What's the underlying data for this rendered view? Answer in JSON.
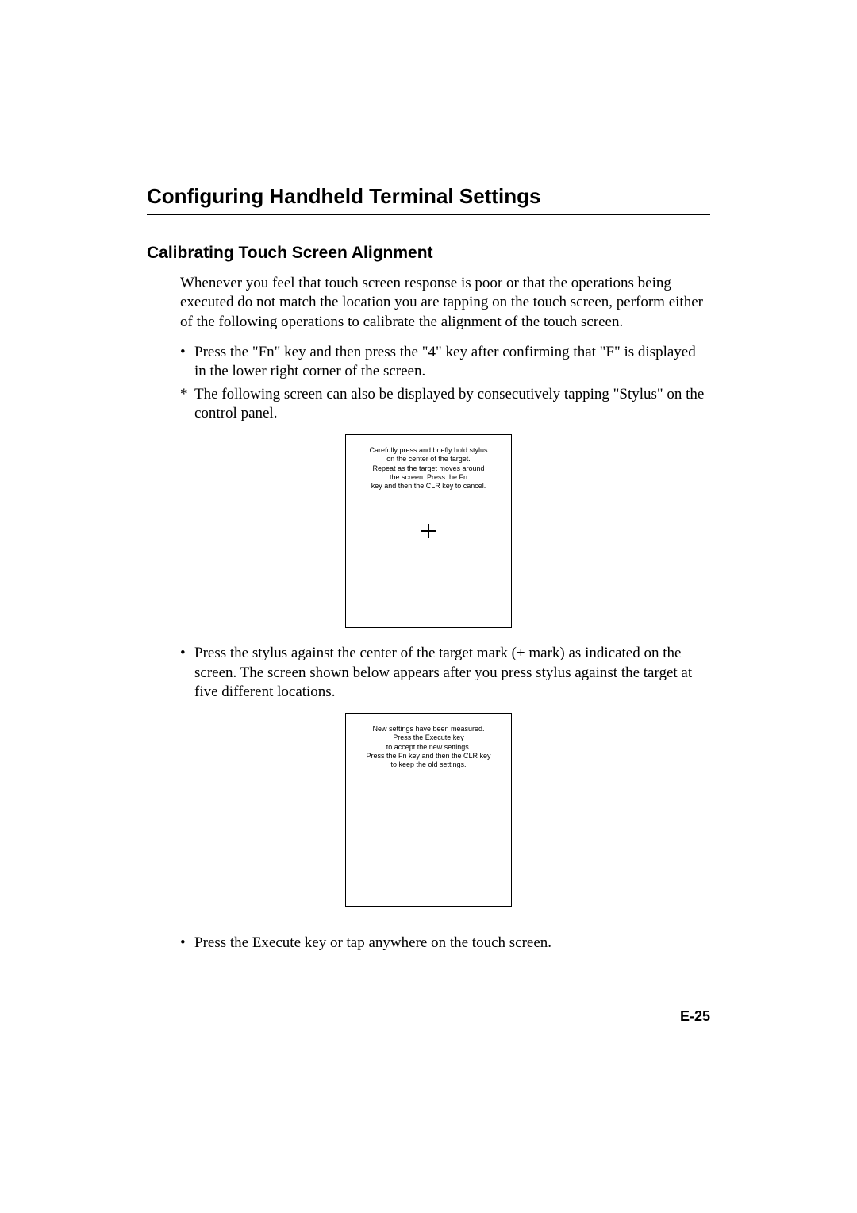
{
  "headings": {
    "main": "Configuring Handheld Terminal Settings",
    "sub": "Calibrating Touch Screen Alignment"
  },
  "paragraphs": {
    "intro": "Whenever you feel that touch screen response is poor or that the operations being executed do not match the location you are tapping on the touch screen, perform either of the following operations to calibrate the alignment of the touch screen."
  },
  "bullets": {
    "b1_mark": "•",
    "b1_text": "Press the \"Fn\" key and then press the \"4\" key after confirming that \"F\" is displayed in the lower right corner of the screen.",
    "b2_mark": "*",
    "b2_text": "The following screen can also be displayed by consecutively tapping \"Stylus\" on the control panel.",
    "b3_mark": "•",
    "b3_text": "Press the stylus against the center of the target mark (+ mark) as indicated on the screen. The screen shown below appears after you press stylus against the target at five different locations.",
    "b4_mark": "•",
    "b4_text": "Press the Execute key or tap anywhere on the touch screen."
  },
  "screens": {
    "s1_line1": "Carefully press and briefly hold stylus",
    "s1_line2": "on the center of the target.",
    "s1_line3": "Repeat as the target moves around",
    "s1_line4": "the screen. Press the Fn",
    "s1_line5": "key and then the CLR key to cancel.",
    "s2_line1": "New settings have been measured.",
    "s2_line2": "Press the Execute key",
    "s2_line3": "to accept the new settings.",
    "s2_line4": "Press the Fn key and then the CLR key",
    "s2_line5": "to keep the old settings."
  },
  "page_number": "E-25"
}
